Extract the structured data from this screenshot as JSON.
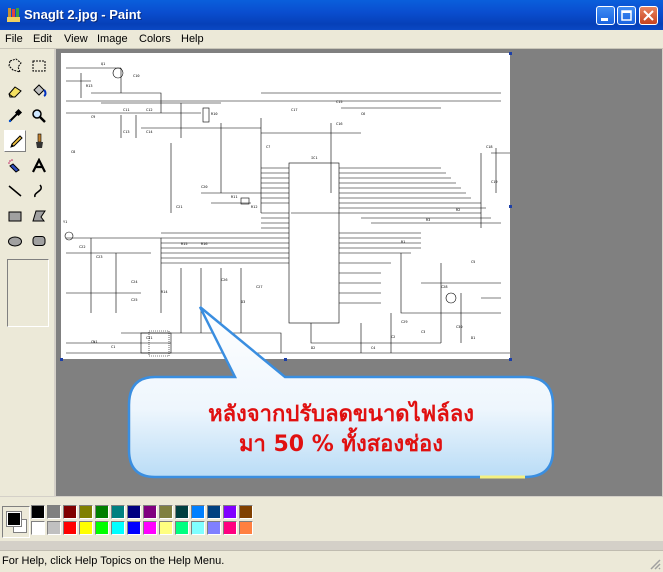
{
  "window": {
    "title": "SnagIt 2.jpg - Paint"
  },
  "menu": [
    "File",
    "Edit",
    "View",
    "Image",
    "Colors",
    "Help"
  ],
  "tools": [
    "free-form-select",
    "select",
    "eraser",
    "fill-with-color",
    "pick-color",
    "magnifier",
    "pencil",
    "brush",
    "airbrush",
    "text",
    "line",
    "curve",
    "rectangle",
    "polygon",
    "ellipse",
    "rounded-rectangle"
  ],
  "callout": {
    "line1": "หลังจากปรับลดขนาดไฟล์ลง",
    "line2": "มา 50 % ทั้งสองช่อง"
  },
  "palette": {
    "foreground": "#000000",
    "background": "#ffffff",
    "row1": [
      "#000000",
      "#808080",
      "#800000",
      "#808000",
      "#008000",
      "#008080",
      "#000080",
      "#800080",
      "#808040",
      "#004040",
      "#0080ff",
      "#004080",
      "#8000ff",
      "#804000"
    ],
    "row2": [
      "#ffffff",
      "#c0c0c0",
      "#ff0000",
      "#ffff00",
      "#00ff00",
      "#00ffff",
      "#0000ff",
      "#ff00ff",
      "#ffff80",
      "#00ff80",
      "#80ffff",
      "#8080ff",
      "#ff0080",
      "#ff8040"
    ]
  },
  "status": {
    "text": "For Help, click Help Topics on the Help Menu."
  },
  "schematic_labels": [
    "Q1",
    "C10",
    "R13",
    "C11",
    "C12",
    "C13",
    "C14",
    "C15",
    "C16",
    "C17",
    "C18",
    "C19",
    "C20",
    "C21",
    "R10",
    "R11",
    "R12",
    "Y1",
    "IC1",
    "C22",
    "C23",
    "C24",
    "C25",
    "R14",
    "R15",
    "R16",
    "C26",
    "C27",
    "C28",
    "C29",
    "C30",
    "C31",
    "CN1",
    "C1",
    "C2",
    "C3",
    "C4",
    "D1",
    "D2",
    "D3",
    "R1",
    "R2",
    "R3",
    "C5",
    "C6",
    "C7",
    "C8",
    "C9"
  ]
}
